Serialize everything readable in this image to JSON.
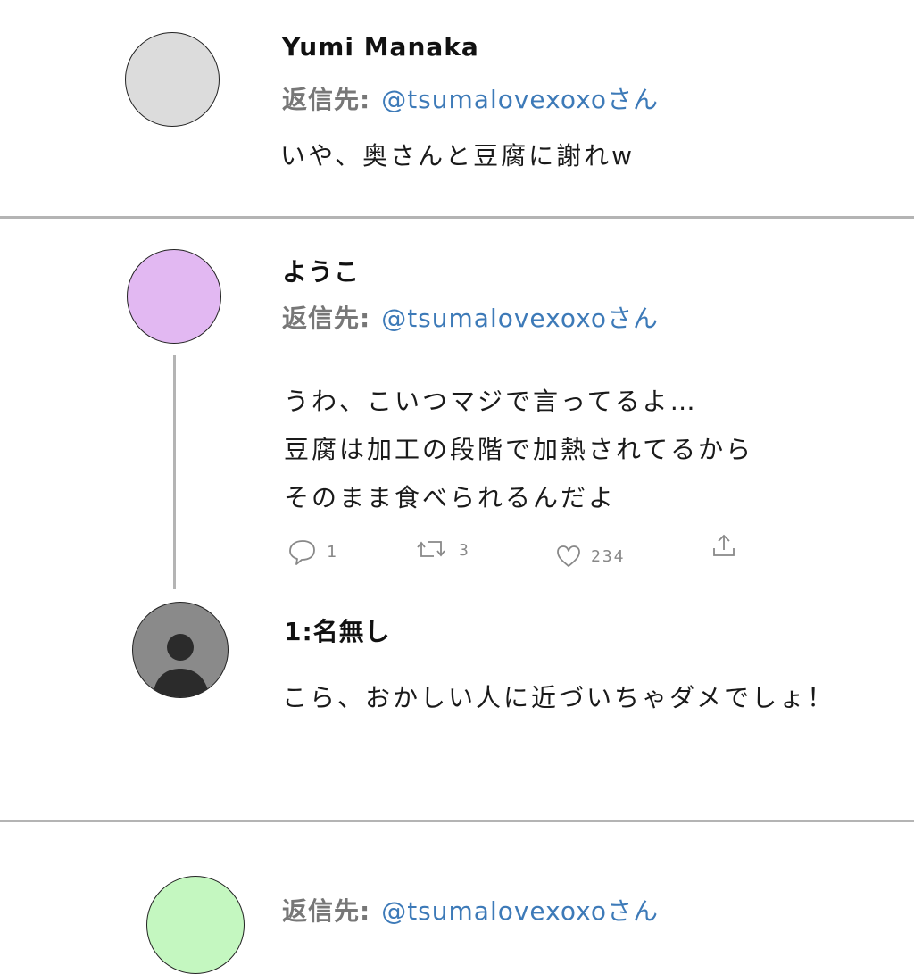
{
  "posts": [
    {
      "name": "Yumi Manaka",
      "reply_label": "返信先:",
      "reply_handle": "@tsumalovexoxoさん",
      "text": "いや、奥さんと豆腐に謝れw",
      "avatar_color": "#dcdcdc"
    },
    {
      "name": "ようこ",
      "reply_label": "返信先:",
      "reply_handle": "@tsumalovexoxoさん",
      "lines": [
        "うわ、こいつマジで言ってるよ…",
        "豆腐は加工の段階で加熱されてるから",
        "そのまま食べられるんだよ"
      ],
      "avatar_color": "#e2b8f2",
      "actions": {
        "reply_count": "1",
        "retweet_count": "3",
        "like_count": "234"
      }
    },
    {
      "name": "1:名無し",
      "text": "こら、おかしい人に近づいちゃダメでしょ！",
      "avatar_color": "#8a8a8a"
    },
    {
      "reply_label": "返信先:",
      "reply_handle": "@tsumalovexoxoさん",
      "avatar_color": "#c4f7c0"
    }
  ],
  "colors": {
    "handle": "#3d7ab8",
    "divider": "#b4b4b4",
    "muted": "#777777"
  },
  "icons": [
    "reply-icon",
    "retweet-icon",
    "like-icon",
    "share-icon",
    "default-user-icon"
  ]
}
